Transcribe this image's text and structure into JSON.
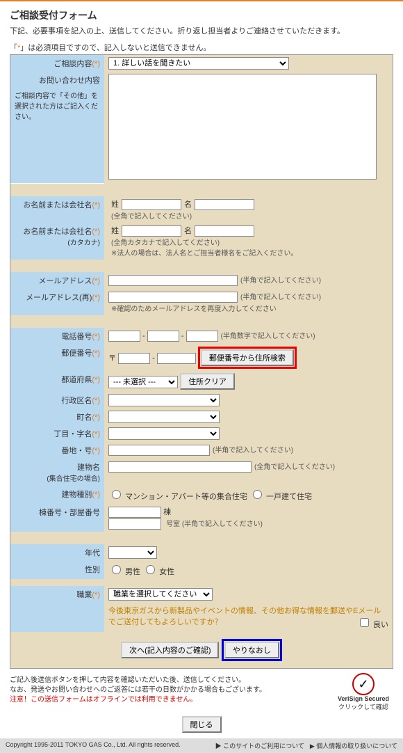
{
  "title": "ご相談受付フォーム",
  "lead": "下記、必要事項を記入の上、送信してください。折り返し担当者よりご連絡させていただきます。",
  "req_note_pre": "「",
  "req_note_mark": "*",
  "req_note_post": "」は必須項目ですので、記入しないと送信できません。",
  "labels": {
    "content": "ご相談内容",
    "inquiry": "お問い合わせ内容",
    "inquiry_sub": "ご相談内容で「その他」を選択された方はご記入ください。",
    "name": "お名前または会社名",
    "name_kana": "お名前または会社名",
    "name_kana_sub": "(カタカナ)",
    "email": "メールアドレス",
    "email2": "メールアドレス(再)",
    "tel": "電話番号",
    "zip": "郵便番号",
    "pref": "都道府県",
    "city": "行政区名",
    "town": "町名",
    "chome": "丁目・字名",
    "banchi": "番地・号",
    "building": "建物名",
    "building_sub": "(集合住宅の場合)",
    "buildtype": "建物種別",
    "room": "棟番号・部屋番号",
    "age": "年代",
    "gender": "性別",
    "job": "職業"
  },
  "content_options": [
    "1. 詳しい話を聞きたい"
  ],
  "name_sei": "姓",
  "name_mei": "名",
  "hint_full": "(全角で記入してください)",
  "hint_half": "(半角で記入してください)",
  "hint_kana": "(全角カタカナで記入してください)",
  "hint_kana2": "※法人の場合は、法人名とご担当者様名をご記入ください。",
  "hint_email2": "※確認のためメールアドレスを再度入力してください",
  "hint_tel": "(半角数字で記入してください)",
  "zip_mark": "〒",
  "zip_btn": "郵便番号から住所検索",
  "addr_clear": "住所クリア",
  "pref_default": "--- 未選択 ---",
  "build_mansion": "マンション・アパート等の集合住宅",
  "build_house": "一戸建て住宅",
  "room_unit": "棟",
  "room_unit2": "号室 (半角で記入してください)",
  "gender_m": "男性",
  "gender_f": "女性",
  "job_default": "職業を選択してください",
  "opt_in": "今後東京ガスから新製品やイベントの情報、その他お得な情報を郵送やEメールでご送付してもよろしいですか？",
  "opt_in_yes": "良い",
  "btn_confirm": "次へ(記入内容のご確認)",
  "btn_reset": "やりなおし",
  "btn_close": "閉じる",
  "note1": "ご記入後送信ボタンを押して内容を確認いただいた後、送信してください。",
  "note2": "なお、発送やお問い合わせへのご返答には若干の日数がかかる場合もございます。",
  "note3": "注意！この送信フォームはオフラインでは利用できません。",
  "verisign": "VeriSign Secured",
  "verisign_sub": "クリックして確認",
  "copyright": "Copyright 1995-2011 TOKYO GAS Co., Ltd. All rights reserved.",
  "foot1": "このサイトのご利用について",
  "foot2": "個人情報の取り扱いについて"
}
